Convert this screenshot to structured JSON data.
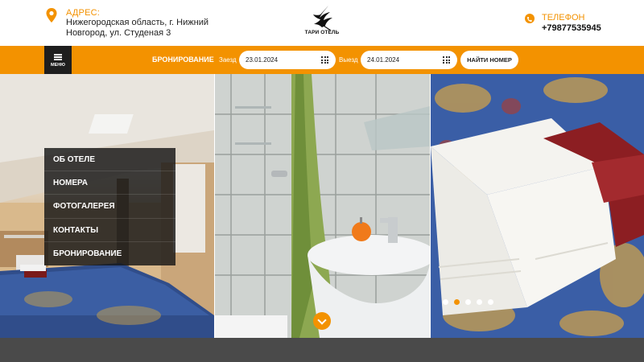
{
  "header": {
    "address_label": "АДРЕС:",
    "address_text": "Нижегородская область, г. Нижний Новгород, ул. Студеная 3",
    "logo_text": "ТАРИ ОТЕЛЬ",
    "phone_label": "ТЕЛЕФОН",
    "phone_value": "+79877535945",
    "icons": {
      "address": "location-pin-icon",
      "phone": "phone-icon",
      "logo": "bird-logo"
    }
  },
  "booking": {
    "menu_label": "МЕНЮ",
    "title": "БРОНИРОВАНИЕ",
    "checkin_label": "Заезд",
    "checkin_value": "23.01.2024",
    "checkout_label": "Выезд",
    "checkout_value": "24.01.2024",
    "find_button": "НАЙТИ НОМЕР"
  },
  "menu": {
    "items": [
      {
        "label": "ОБ ОТЕЛЕ"
      },
      {
        "label": "НОМЕРА"
      },
      {
        "label": "ФОТОГАЛЕРЕЯ"
      },
      {
        "label": "КОНТАКТЫ"
      },
      {
        "label": "БРОНИРОВАНИЕ"
      }
    ]
  },
  "slider": {
    "dot_count": 5,
    "active_dot": 2
  },
  "colors": {
    "accent": "#f39200",
    "dark": "#1e1e1e",
    "footer": "#4a4a4a"
  }
}
